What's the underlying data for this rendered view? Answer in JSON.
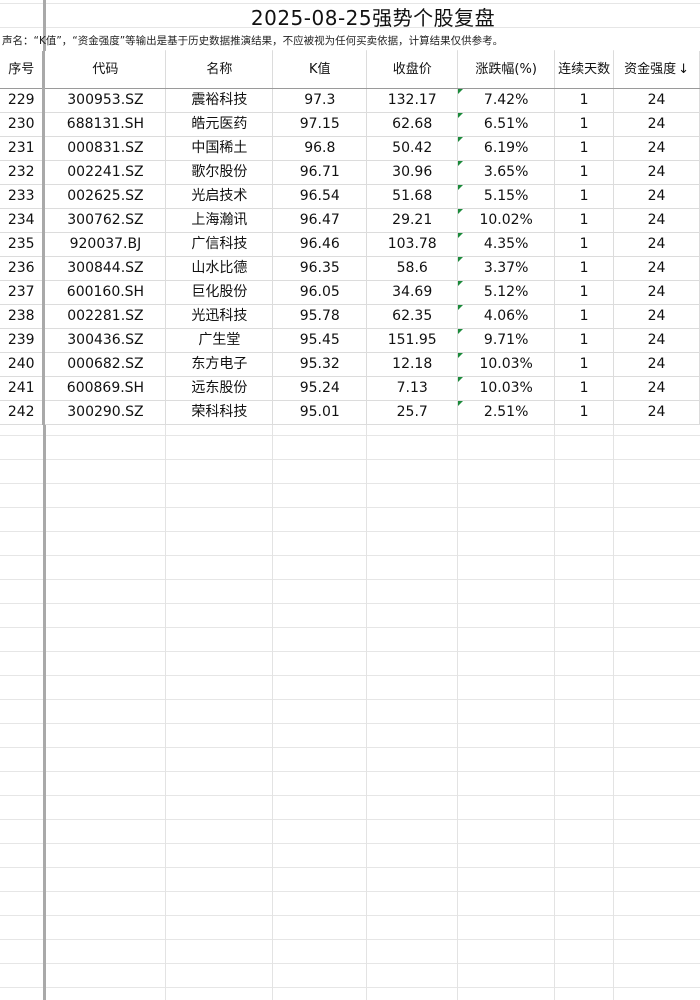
{
  "sheet": {
    "title": "2025-08-25强势个股复盘",
    "disclaimer": "声名：“K值”，“资金强度”等输出是基于历史数据推演结果，不应被视为任何买卖依据，计算结果仅供参考。",
    "headers": {
      "seq": "序号",
      "code": "代码",
      "name": "名称",
      "k": "K值",
      "close": "收盘价",
      "change": "涨跌幅(%)",
      "days": "连续天数",
      "strength": "资金强度",
      "sort_icon": "↓"
    },
    "rows": [
      {
        "seq": "229",
        "code": "300953.SZ",
        "name": "震裕科技",
        "k": "97.3",
        "close": "132.17",
        "change": "7.42%",
        "days": "1",
        "strength": "24"
      },
      {
        "seq": "230",
        "code": "688131.SH",
        "name": "皓元医药",
        "k": "97.15",
        "close": "62.68",
        "change": "6.51%",
        "days": "1",
        "strength": "24"
      },
      {
        "seq": "231",
        "code": "000831.SZ",
        "name": "中国稀土",
        "k": "96.8",
        "close": "50.42",
        "change": "6.19%",
        "days": "1",
        "strength": "24"
      },
      {
        "seq": "232",
        "code": "002241.SZ",
        "name": "歌尔股份",
        "k": "96.71",
        "close": "30.96",
        "change": "3.65%",
        "days": "1",
        "strength": "24"
      },
      {
        "seq": "233",
        "code": "002625.SZ",
        "name": "光启技术",
        "k": "96.54",
        "close": "51.68",
        "change": "5.15%",
        "days": "1",
        "strength": "24"
      },
      {
        "seq": "234",
        "code": "300762.SZ",
        "name": "上海瀚讯",
        "k": "96.47",
        "close": "29.21",
        "change": "10.02%",
        "days": "1",
        "strength": "24"
      },
      {
        "seq": "235",
        "code": "920037.BJ",
        "name": "广信科技",
        "k": "96.46",
        "close": "103.78",
        "change": "4.35%",
        "days": "1",
        "strength": "24"
      },
      {
        "seq": "236",
        "code": "300844.SZ",
        "name": "山水比德",
        "k": "96.35",
        "close": "58.6",
        "change": "3.37%",
        "days": "1",
        "strength": "24"
      },
      {
        "seq": "237",
        "code": "600160.SH",
        "name": "巨化股份",
        "k": "96.05",
        "close": "34.69",
        "change": "5.12%",
        "days": "1",
        "strength": "24"
      },
      {
        "seq": "238",
        "code": "002281.SZ",
        "name": "光迅科技",
        "k": "95.78",
        "close": "62.35",
        "change": "4.06%",
        "days": "1",
        "strength": "24"
      },
      {
        "seq": "239",
        "code": "300436.SZ",
        "name": "广生堂",
        "k": "95.45",
        "close": "151.95",
        "change": "9.71%",
        "days": "1",
        "strength": "24"
      },
      {
        "seq": "240",
        "code": "000682.SZ",
        "name": "东方电子",
        "k": "95.32",
        "close": "12.18",
        "change": "10.03%",
        "days": "1",
        "strength": "24"
      },
      {
        "seq": "241",
        "code": "600869.SH",
        "name": "远东股份",
        "k": "95.24",
        "close": "7.13",
        "change": "10.03%",
        "days": "1",
        "strength": "24"
      },
      {
        "seq": "242",
        "code": "300290.SZ",
        "name": "荣科科技",
        "k": "95.01",
        "close": "25.7",
        "change": "2.51%",
        "days": "1",
        "strength": "24"
      }
    ],
    "flag_color": "#1b8a3a"
  }
}
